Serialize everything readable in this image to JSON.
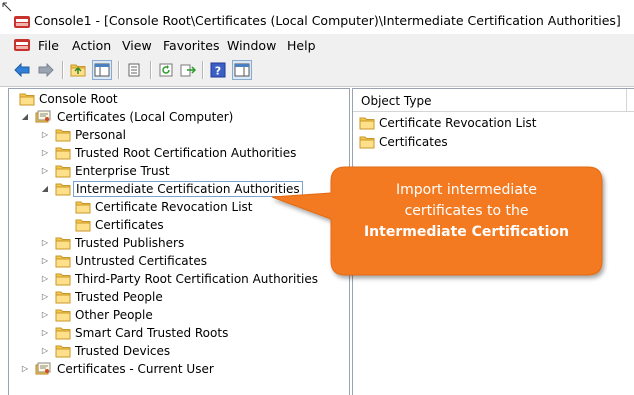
{
  "window": {
    "title": "Console1 - [Console Root\\Certificates (Local Computer)\\Intermediate Certification Authorities]"
  },
  "menu": [
    "File",
    "Action",
    "View",
    "Favorites",
    "Window",
    "Help"
  ],
  "toolbar": {
    "buttons": [
      "back-arrow-icon",
      "forward-arrow-icon",
      "up-folder-icon",
      "show-tree-icon",
      "properties-icon",
      "refresh-icon",
      "export-list-icon",
      "help-icon",
      "show-action-pane-icon"
    ]
  },
  "tree": {
    "root": "Console Root",
    "local": "Certificates (Local Computer)",
    "items": [
      "Personal",
      "Trusted Root Certification Authorities",
      "Enterprise Trust",
      "Intermediate Certification Authorities",
      "Certificate Revocation List",
      "Certificates",
      "Trusted Publishers",
      "Untrusted Certificates",
      "Third-Party Root Certification Authorities",
      "Trusted People",
      "Other People",
      "Smart Card Trusted Roots",
      "Trusted Devices"
    ],
    "current_user": "Certificates - Current User"
  },
  "list": {
    "column_header": "Object Type",
    "rows": [
      "Certificate Revocation List",
      "Certificates"
    ]
  },
  "callout": {
    "line1": "Import intermediate",
    "line2": "certificates to the",
    "line3": "Intermediate Certification",
    "color": "#f47a20"
  }
}
